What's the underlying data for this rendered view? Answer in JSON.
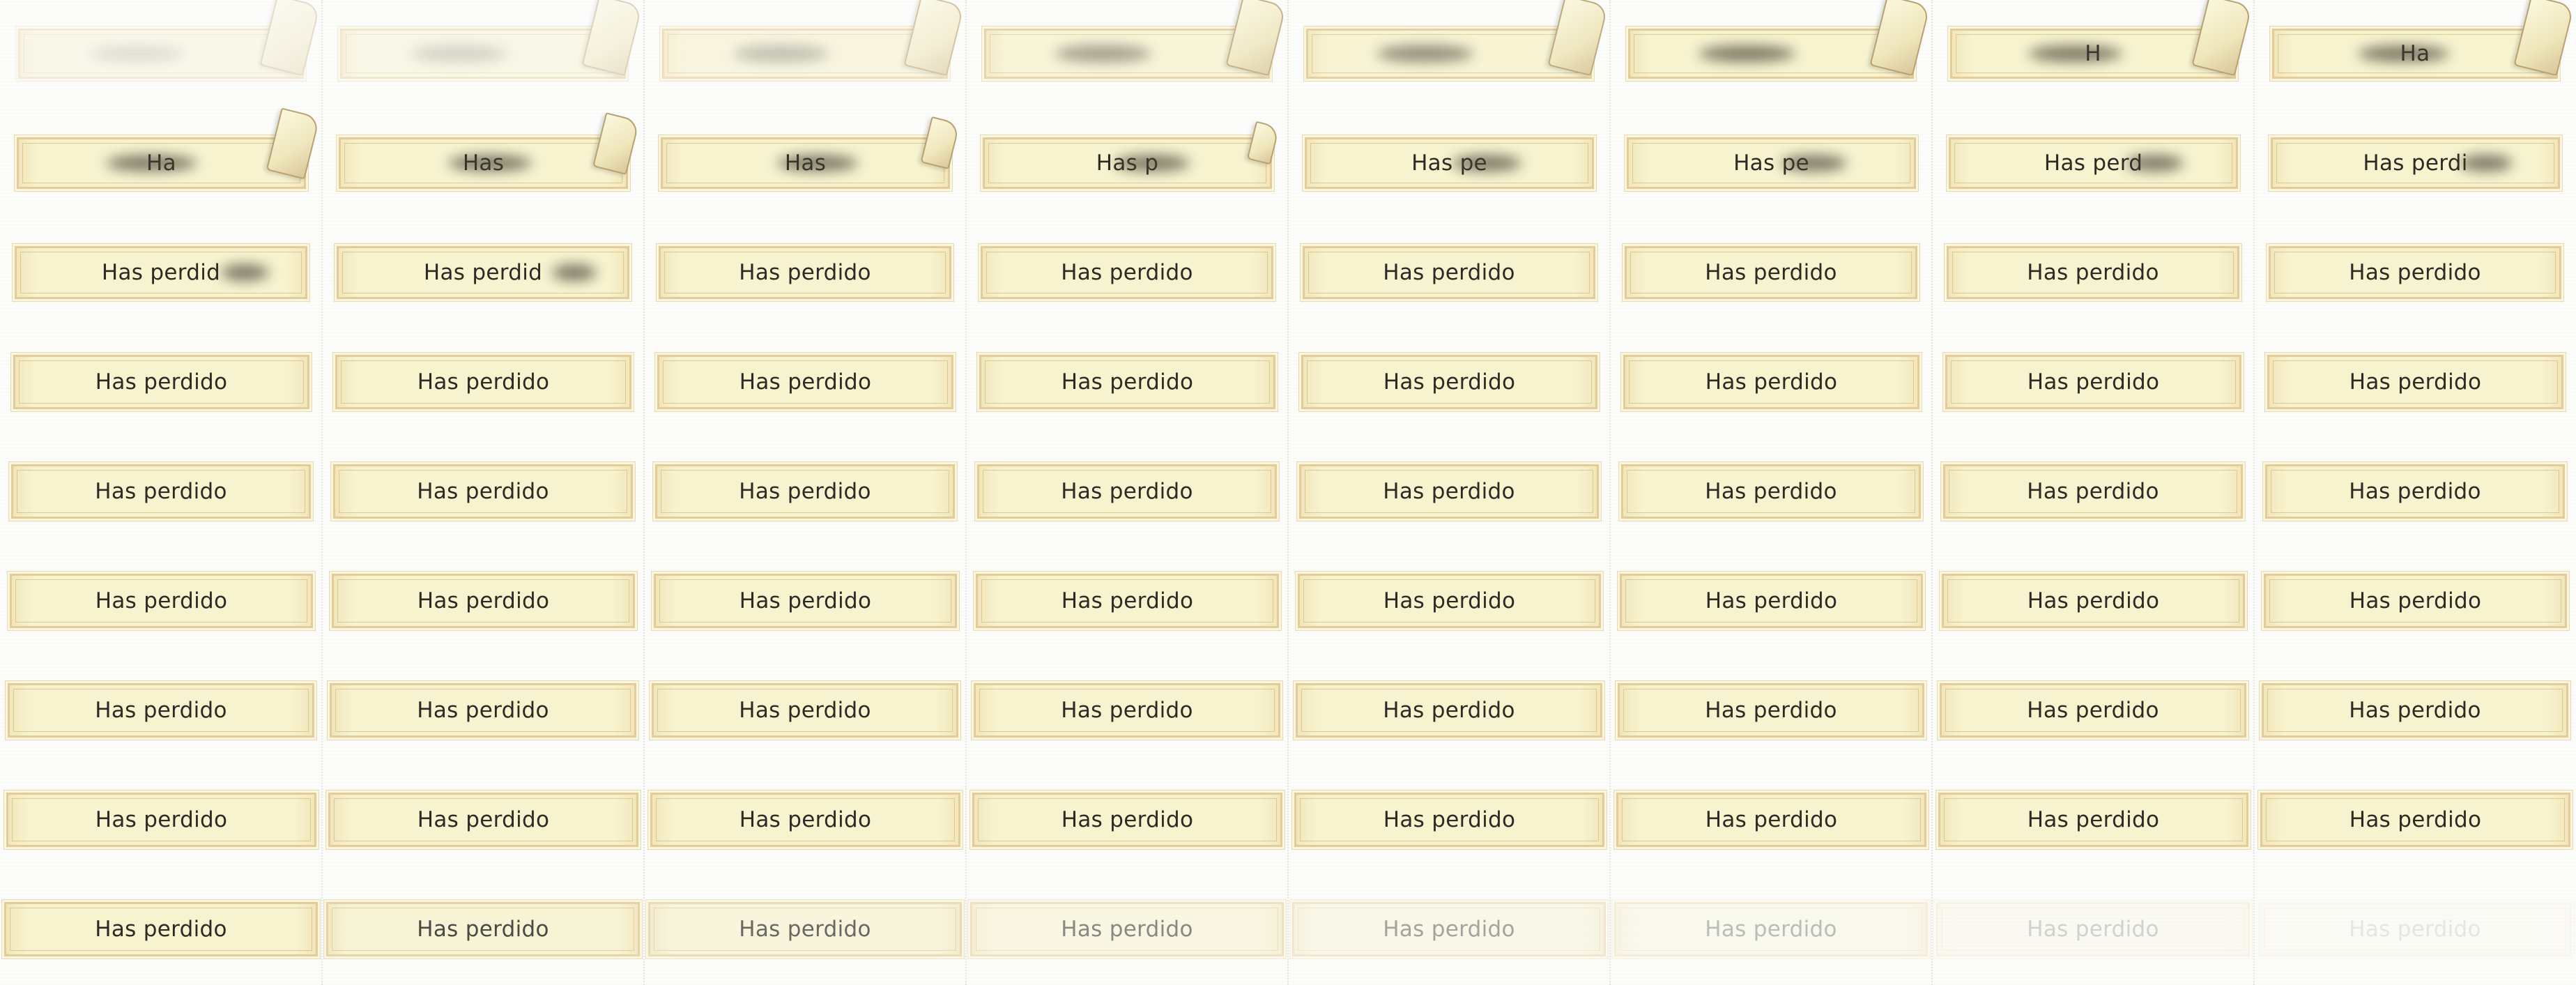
{
  "sheet": {
    "title_text": "Has perdido",
    "columns": 8,
    "rows": 9,
    "colors": {
      "background": "#fcfcfb",
      "banner_fill": "#f7f3cf",
      "banner_border": "#e4cc98",
      "text": "#2b2a24"
    },
    "frames": [
      {
        "label": "",
        "reveal": 0.0,
        "opacity": 0.35,
        "curl": 1.0
      },
      {
        "label": "",
        "reveal": 0.0,
        "opacity": 0.45,
        "curl": 1.0
      },
      {
        "label": "",
        "reveal": 0.0,
        "opacity": 0.6,
        "curl": 1.0
      },
      {
        "label": "",
        "reveal": 0.0,
        "opacity": 0.8,
        "curl": 1.0
      },
      {
        "label": "",
        "reveal": 0.0,
        "opacity": 0.9,
        "curl": 1.0
      },
      {
        "label": "",
        "reveal": 0.0,
        "opacity": 1.0,
        "curl": 1.0
      },
      {
        "label": "H",
        "reveal": 0.05,
        "opacity": 1.0,
        "curl": 1.0
      },
      {
        "label": "Ha",
        "reveal": 0.1,
        "opacity": 1.0,
        "curl": 1.0
      },
      {
        "label": "Ha",
        "reveal": 0.12,
        "opacity": 1.0,
        "curl": 0.8
      },
      {
        "label": "Has",
        "reveal": 0.25,
        "opacity": 1.0,
        "curl": 0.6
      },
      {
        "label": "Has",
        "reveal": 0.3,
        "opacity": 1.0,
        "curl": 0.4
      },
      {
        "label": "Has p",
        "reveal": 0.4,
        "opacity": 1.0,
        "curl": 0.2
      },
      {
        "label": "Has pe",
        "reveal": 0.5,
        "opacity": 1.0,
        "curl": 0.0
      },
      {
        "label": "Has pe",
        "reveal": 0.55,
        "opacity": 1.0,
        "curl": 0.0
      },
      {
        "label": "Has perd",
        "reveal": 0.7,
        "opacity": 1.0,
        "curl": 0.0
      },
      {
        "label": "Has perdi",
        "reveal": 0.78,
        "opacity": 1.0,
        "curl": 0.0
      },
      {
        "label": "Has perdid",
        "reveal": 0.88,
        "opacity": 1.0,
        "curl": 0.0
      },
      {
        "label": "Has perdid",
        "reveal": 0.94,
        "opacity": 1.0,
        "curl": 0.0
      },
      {
        "label": "Has perdido",
        "reveal": 1.0,
        "opacity": 1.0,
        "curl": 0.0
      },
      {
        "label": "Has perdido",
        "reveal": 1.0,
        "opacity": 1.0,
        "curl": 0.0
      },
      {
        "label": "Has perdido",
        "reveal": 1.0,
        "opacity": 1.0,
        "curl": 0.0
      },
      {
        "label": "Has perdido",
        "reveal": 1.0,
        "opacity": 1.0,
        "curl": 0.0
      },
      {
        "label": "Has perdido",
        "reveal": 1.0,
        "opacity": 1.0,
        "curl": 0.0
      },
      {
        "label": "Has perdido",
        "reveal": 1.0,
        "opacity": 1.0,
        "curl": 0.0
      },
      {
        "label": "Has perdido",
        "reveal": 1.0,
        "opacity": 1.0,
        "curl": 0.0
      },
      {
        "label": "Has perdido",
        "reveal": 1.0,
        "opacity": 1.0,
        "curl": 0.0
      },
      {
        "label": "Has perdido",
        "reveal": 1.0,
        "opacity": 1.0,
        "curl": 0.0
      },
      {
        "label": "Has perdido",
        "reveal": 1.0,
        "opacity": 1.0,
        "curl": 0.0
      },
      {
        "label": "Has perdido",
        "reveal": 1.0,
        "opacity": 1.0,
        "curl": 0.0
      },
      {
        "label": "Has perdido",
        "reveal": 1.0,
        "opacity": 1.0,
        "curl": 0.0
      },
      {
        "label": "Has perdido",
        "reveal": 1.0,
        "opacity": 1.0,
        "curl": 0.0
      },
      {
        "label": "Has perdido",
        "reveal": 1.0,
        "opacity": 1.0,
        "curl": 0.0
      },
      {
        "label": "Has perdido",
        "reveal": 1.0,
        "opacity": 1.0,
        "curl": 0.0
      },
      {
        "label": "Has perdido",
        "reveal": 1.0,
        "opacity": 1.0,
        "curl": 0.0
      },
      {
        "label": "Has perdido",
        "reveal": 1.0,
        "opacity": 1.0,
        "curl": 0.0
      },
      {
        "label": "Has perdido",
        "reveal": 1.0,
        "opacity": 1.0,
        "curl": 0.0
      },
      {
        "label": "Has perdido",
        "reveal": 1.0,
        "opacity": 1.0,
        "curl": 0.0
      },
      {
        "label": "Has perdido",
        "reveal": 1.0,
        "opacity": 1.0,
        "curl": 0.0
      },
      {
        "label": "Has perdido",
        "reveal": 1.0,
        "opacity": 1.0,
        "curl": 0.0
      },
      {
        "label": "Has perdido",
        "reveal": 1.0,
        "opacity": 1.0,
        "curl": 0.0
      },
      {
        "label": "Has perdido",
        "reveal": 1.0,
        "opacity": 1.0,
        "curl": 0.0
      },
      {
        "label": "Has perdido",
        "reveal": 1.0,
        "opacity": 1.0,
        "curl": 0.0
      },
      {
        "label": "Has perdido",
        "reveal": 1.0,
        "opacity": 1.0,
        "curl": 0.0
      },
      {
        "label": "Has perdido",
        "reveal": 1.0,
        "opacity": 1.0,
        "curl": 0.0
      },
      {
        "label": "Has perdido",
        "reveal": 1.0,
        "opacity": 1.0,
        "curl": 0.0
      },
      {
        "label": "Has perdido",
        "reveal": 1.0,
        "opacity": 1.0,
        "curl": 0.0
      },
      {
        "label": "Has perdido",
        "reveal": 1.0,
        "opacity": 1.0,
        "curl": 0.0
      },
      {
        "label": "Has perdido",
        "reveal": 1.0,
        "opacity": 1.0,
        "curl": 0.0
      },
      {
        "label": "Has perdido",
        "reveal": 1.0,
        "opacity": 1.0,
        "curl": 0.0
      },
      {
        "label": "Has perdido",
        "reveal": 1.0,
        "opacity": 1.0,
        "curl": 0.0
      },
      {
        "label": "Has perdido",
        "reveal": 1.0,
        "opacity": 1.0,
        "curl": 0.0
      },
      {
        "label": "Has perdido",
        "reveal": 1.0,
        "opacity": 1.0,
        "curl": 0.0
      },
      {
        "label": "Has perdido",
        "reveal": 1.0,
        "opacity": 1.0,
        "curl": 0.0
      },
      {
        "label": "Has perdido",
        "reveal": 1.0,
        "opacity": 1.0,
        "curl": 0.0
      },
      {
        "label": "Has perdido",
        "reveal": 1.0,
        "opacity": 1.0,
        "curl": 0.0
      },
      {
        "label": "Has perdido",
        "reveal": 1.0,
        "opacity": 1.0,
        "curl": 0.0
      },
      {
        "label": "Has perdido",
        "reveal": 1.0,
        "opacity": 1.0,
        "curl": 0.0
      },
      {
        "label": "Has perdido",
        "reveal": 1.0,
        "opacity": 1.0,
        "curl": 0.0
      },
      {
        "label": "Has perdido",
        "reveal": 1.0,
        "opacity": 1.0,
        "curl": 0.0
      },
      {
        "label": "Has perdido",
        "reveal": 1.0,
        "opacity": 1.0,
        "curl": 0.0
      },
      {
        "label": "Has perdido",
        "reveal": 1.0,
        "opacity": 1.0,
        "curl": 0.0
      },
      {
        "label": "Has perdido",
        "reveal": 1.0,
        "opacity": 1.0,
        "curl": 0.0
      },
      {
        "label": "Has perdido",
        "reveal": 1.0,
        "opacity": 1.0,
        "curl": 0.0
      },
      {
        "label": "Has perdido",
        "reveal": 1.0,
        "opacity": 1.0,
        "curl": 0.0
      },
      {
        "label": "Has perdido",
        "reveal": 1.0,
        "opacity": 1.0,
        "curl": 0.0
      },
      {
        "label": "Has perdido",
        "reveal": 1.0,
        "opacity": 0.85,
        "curl": 0.0
      },
      {
        "label": "Has perdido",
        "reveal": 1.0,
        "opacity": 0.7,
        "curl": 0.0
      },
      {
        "label": "Has perdido",
        "reveal": 1.0,
        "opacity": 0.55,
        "curl": 0.0
      },
      {
        "label": "Has perdido",
        "reveal": 1.0,
        "opacity": 0.42,
        "curl": 0.0
      },
      {
        "label": "Has perdido",
        "reveal": 1.0,
        "opacity": 0.3,
        "curl": 0.0
      },
      {
        "label": "Has perdido",
        "reveal": 1.0,
        "opacity": 0.2,
        "curl": 0.0
      },
      {
        "label": "Has perdido",
        "reveal": 1.0,
        "opacity": 0.1,
        "curl": 0.0
      }
    ]
  }
}
